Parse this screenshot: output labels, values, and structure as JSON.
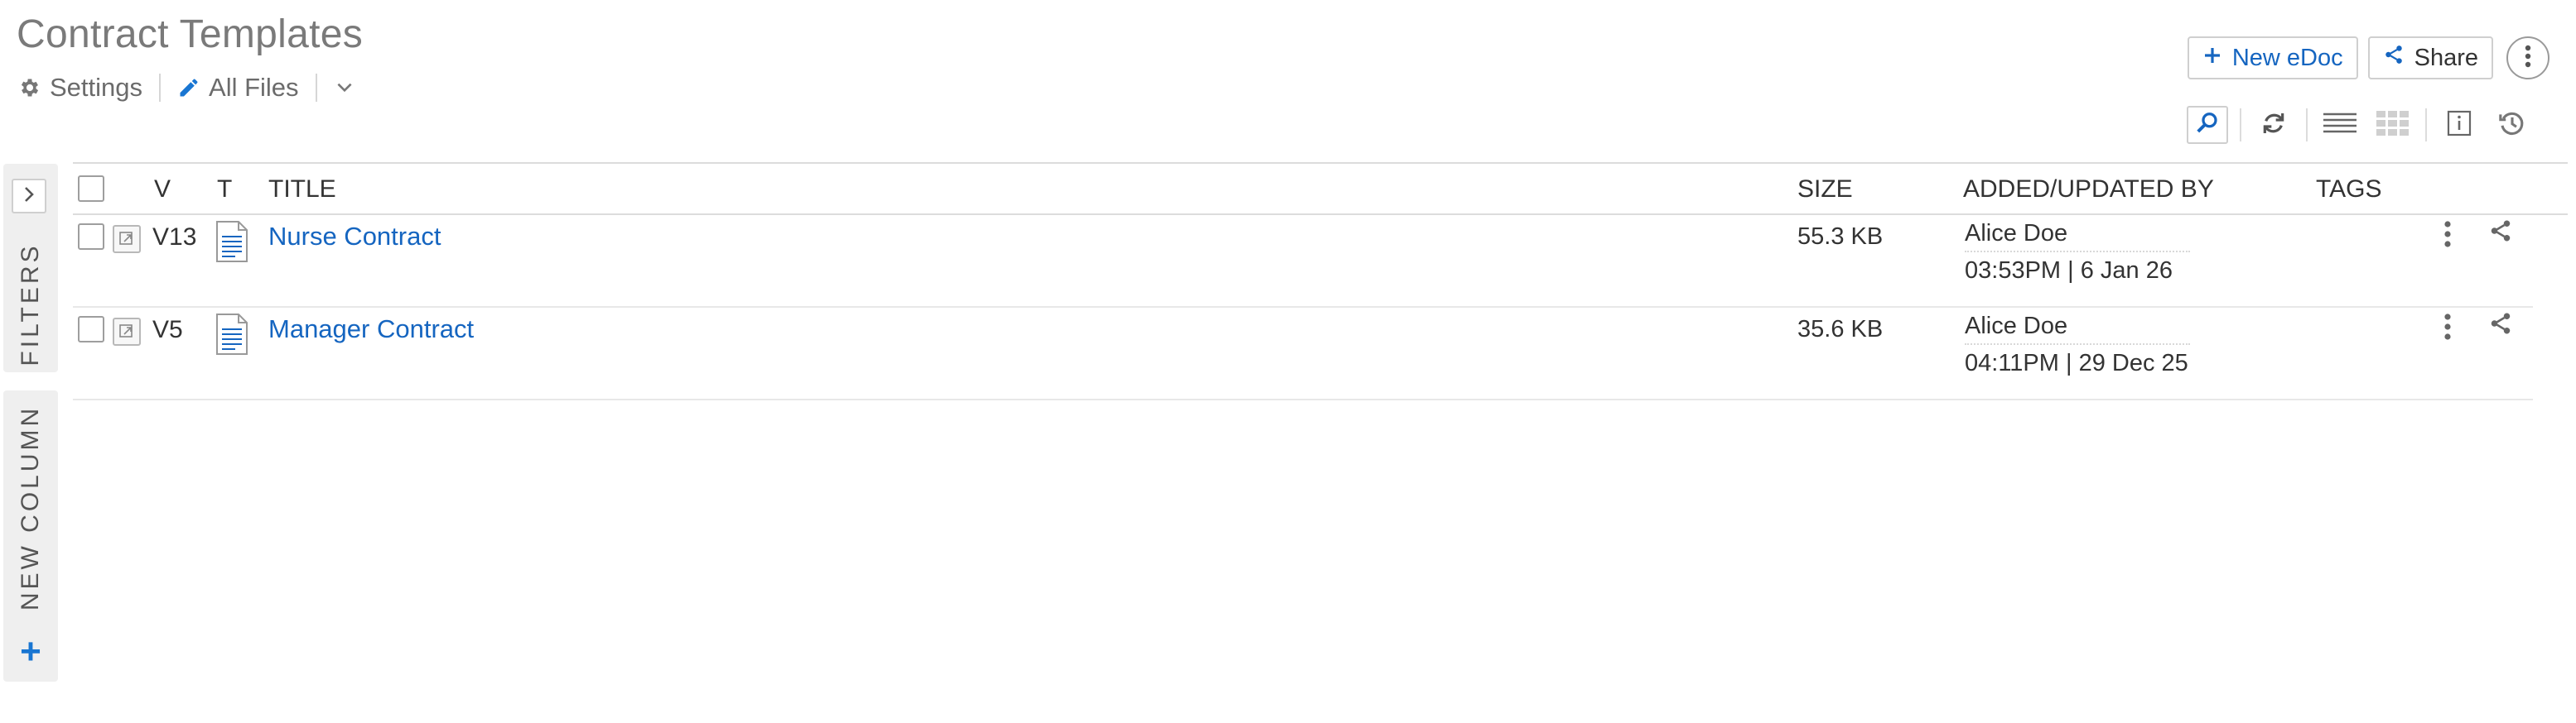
{
  "header": {
    "title": "Contract Templates"
  },
  "subnav": {
    "settings_label": "Settings",
    "view_label": "All Files"
  },
  "actions": {
    "new_label": "New eDoc",
    "share_label": "Share"
  },
  "toolbar": {
    "items": [
      "search-icon",
      "refresh-icon",
      "list-view-icon",
      "grid-view-icon",
      "info-icon",
      "history-icon"
    ]
  },
  "sidebar": {
    "filters_label": "FILTERS",
    "new_column_label": "NEW COLUMN"
  },
  "table": {
    "columns": {
      "version": "V",
      "type": "T",
      "title": "TITLE",
      "size": "SIZE",
      "added_by": "ADDED/UPDATED BY",
      "tags": "TAGS"
    },
    "rows": [
      {
        "version": "V13",
        "title": "Nurse Contract",
        "size": "55.3 KB",
        "by": "Alice Doe",
        "when": "03:53PM | 6 Jan 26"
      },
      {
        "version": "V5",
        "title": "Manager Contract",
        "size": "35.6 KB",
        "by": "Alice Doe",
        "when": "04:11PM | 29 Dec 25"
      }
    ]
  },
  "colors": {
    "accent": "#1565c0",
    "title_gray": "#7a7a7a",
    "border": "#dcdcdc"
  }
}
